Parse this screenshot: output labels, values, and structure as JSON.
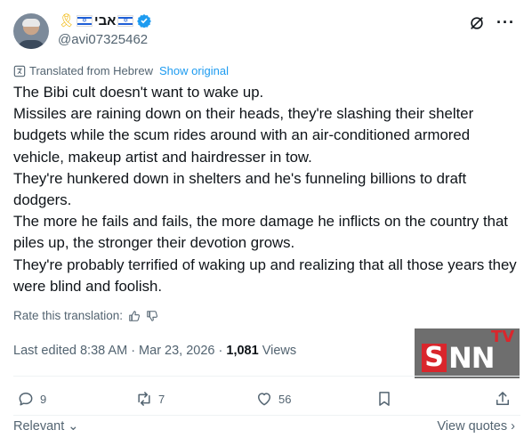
{
  "author": {
    "display_name": "אבי",
    "handle": "@avi07325462"
  },
  "translation": {
    "note": "Translated from Hebrew",
    "show_original": "Show original"
  },
  "post": {
    "paragraphs": [
      "The Bibi cult doesn't want to wake up.",
      "Missiles are raining down on their heads, they're slashing their shelter budgets while the scum rides around with an air-conditioned armored vehicle, makeup artist and hairdresser in tow.",
      "They're hunkered down in shelters and he's funneling billions to draft dodgers.",
      "The more he fails and fails, the more damage he inflicts on the country that piles up, the stronger their devotion grows.",
      "They're probably terrified of waking up and realizing that all those years they were blind and foolish."
    ]
  },
  "rate_translation": "Rate this translation:",
  "meta": {
    "edited": "Last edited 8:38 AM · Mar 23, 2026 · ",
    "views_count": "1,081",
    "views_label": " Views"
  },
  "watermark": {
    "s": "S",
    "nn": "NN",
    "tv": "TV"
  },
  "actions": {
    "replies": "9",
    "reposts": "7",
    "likes": "56"
  },
  "footer": {
    "sort": "Relevant",
    "view_quotes": "View quotes"
  },
  "colors": {
    "accent": "#1d9bf0",
    "secondary_text": "#536471",
    "primary_text": "#0f1419",
    "logo_red": "#d9262c"
  },
  "icons": [
    "yellow-ribbon-icon",
    "israel-flag-icon",
    "verified-badge-icon",
    "grok-icon",
    "more-icon",
    "globe-icon",
    "thumbs-up-icon",
    "thumbs-down-icon",
    "reply-icon",
    "repost-icon",
    "like-icon",
    "bookmark-icon",
    "share-icon",
    "chevron-down-icon",
    "chevron-right-icon"
  ]
}
